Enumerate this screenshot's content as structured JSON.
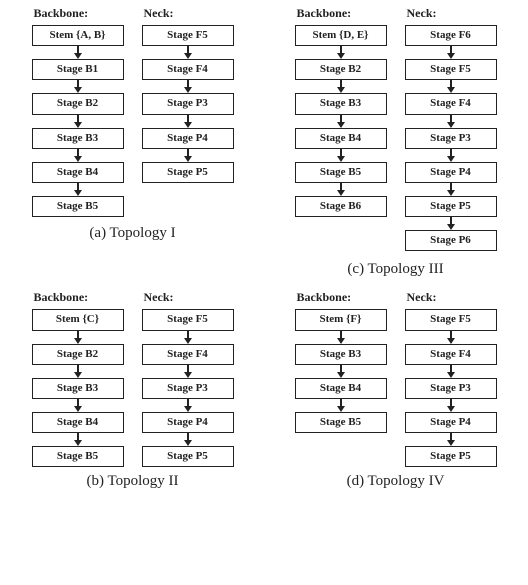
{
  "headers": {
    "backbone": "Backbone:",
    "neck": "Neck:"
  },
  "captions": {
    "a": "(a) Topology I",
    "b": "(b) Topology II",
    "c": "(c) Topology III",
    "d": "(d) Topology IV"
  },
  "topologies": {
    "a": {
      "backbone": [
        "Stem {A, B}",
        "Stage B1",
        "Stage B2",
        "Stage B3",
        "Stage B4",
        "Stage B5"
      ],
      "neck": [
        "Stage F5",
        "Stage F4",
        "Stage P3",
        "Stage P4",
        "Stage P5"
      ]
    },
    "b": {
      "backbone": [
        "Stem {C}",
        "Stage B2",
        "Stage B3",
        "Stage B4",
        "Stage B5"
      ],
      "neck": [
        "Stage F5",
        "Stage F4",
        "Stage P3",
        "Stage P4",
        "Stage P5"
      ]
    },
    "c": {
      "backbone": [
        "Stem {D, E}",
        "Stage B2",
        "Stage B3",
        "Stage B4",
        "Stage B5",
        "Stage B6"
      ],
      "neck": [
        "Stage F6",
        "Stage F5",
        "Stage F4",
        "Stage P3",
        "Stage P4",
        "Stage P5",
        "Stage P6"
      ]
    },
    "d": {
      "backbone": [
        "Stem {F}",
        "Stage B3",
        "Stage B4",
        "Stage B5"
      ],
      "neck": [
        "Stage F5",
        "Stage F4",
        "Stage P3",
        "Stage P4",
        "Stage P5"
      ]
    }
  }
}
